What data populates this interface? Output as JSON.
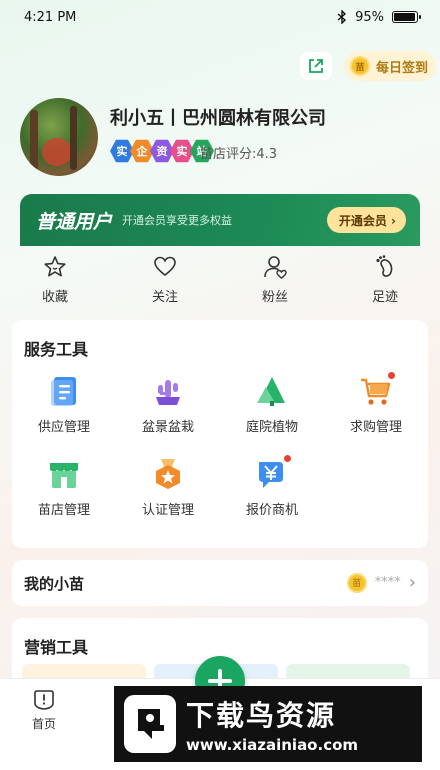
{
  "status_bar": {
    "time": "4:21 PM",
    "battery": "95%",
    "battery_level": 0.95
  },
  "header": {
    "checkin_label": "每日签到",
    "coin_glyph": "苗"
  },
  "profile": {
    "name": "利小五丨巴州圆林有限公司",
    "rating": "苗店评分:4.3",
    "badges": [
      {
        "text": "实",
        "color": "#2f7be0"
      },
      {
        "text": "企",
        "color": "#f08b2a"
      },
      {
        "text": "资",
        "color": "#8c5ae0"
      },
      {
        "text": "实",
        "color": "#e84e8a"
      },
      {
        "text": "站",
        "color": "#26a65b"
      }
    ]
  },
  "membership": {
    "title": "普通用户",
    "subtitle": "开通会员享受更多权益",
    "button": "开通会员 ›"
  },
  "quick_actions": [
    {
      "label": "收藏",
      "icon": "star-icon"
    },
    {
      "label": "关注",
      "icon": "heart-icon"
    },
    {
      "label": "粉丝",
      "icon": "fans-icon"
    },
    {
      "label": "足迹",
      "icon": "footprint-icon"
    }
  ],
  "service_tools": {
    "title": "服务工具",
    "items": [
      {
        "label": "供应管理",
        "icon": "supply-doc-icon"
      },
      {
        "label": "盆景盆栽",
        "icon": "bonsai-icon"
      },
      {
        "label": "庭院植物",
        "icon": "tree-icon"
      },
      {
        "label": "求购管理",
        "icon": "cart-icon"
      },
      {
        "label": "苗店管理",
        "icon": "shop-icon"
      },
      {
        "label": "认证管理",
        "icon": "medal-icon"
      },
      {
        "label": "报价商机",
        "icon": "quote-icon"
      }
    ]
  },
  "my_miao": {
    "title": "我的小苗",
    "value": "****",
    "arrow": "›"
  },
  "marketing": {
    "title": "营销工具"
  },
  "bottom_nav": {
    "home_label": "首页",
    "home_icon_glyph": "!"
  },
  "watermark": {
    "title": "下载鸟资源",
    "url": "www.xiazainiao.com"
  },
  "colors": {
    "brand_green": "#1d8a55",
    "fab_green": "#1aa561",
    "gold": "#f5c232"
  }
}
